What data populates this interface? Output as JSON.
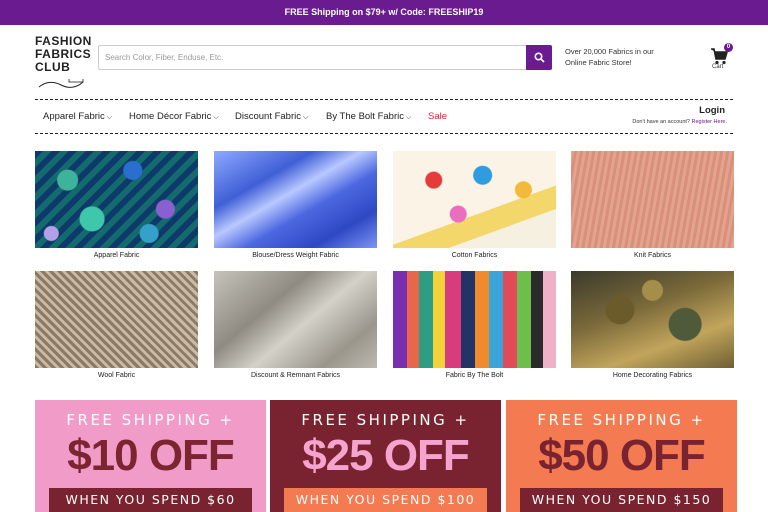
{
  "promo": "FREE Shipping on $79+ w/ Code: FREESHIP19",
  "logo": {
    "line1": "FASHION",
    "line2": "FABRICS",
    "line3": "CLUB"
  },
  "search": {
    "placeholder": "Search Color, Fiber, Enduse, Etc."
  },
  "tagline": "Over 20,000 Fabrics in our Online Fabric Store!",
  "cart": {
    "count": "0",
    "label": "Cart"
  },
  "nav": {
    "items": [
      "Apparel Fabric",
      "Home Décor Fabric",
      "Discount Fabric",
      "By The Bolt Fabric"
    ],
    "sale": "Sale",
    "login": "Login",
    "register_prompt": "Don't have an account?",
    "register_link": "Register Here."
  },
  "categories": [
    "Apparel Fabric",
    "Blouse/Dress Weight Fabric",
    "Cotton Fabrics",
    "Knit Fabrics",
    "Wool Fabric",
    "Discount & Remnant Fabrics",
    "Fabric By The Bolt",
    "Home Decorating Fabrics"
  ],
  "banners": [
    {
      "line1": "FREE SHIPPING +",
      "line2": "$10 OFF",
      "line3": "WHEN YOU SPEND $60"
    },
    {
      "line1": "FREE SHIPPING +",
      "line2": "$25 OFF",
      "line3": "WHEN YOU SPEND $100"
    },
    {
      "line1": "FREE SHIPPING +",
      "line2": "$50 OFF",
      "line3": "WHEN YOU SPEND $150"
    }
  ],
  "colors": {
    "brand": "#6a1b8f",
    "sale": "#e0202e",
    "banner1_bg": "#f19bc9",
    "banner1_text": "#7a2530",
    "banner2_bg": "#7a2330",
    "banner2_text": "#f5a3cf",
    "banner3_bg": "#f47a52",
    "banner3_text": "#7a2330"
  }
}
